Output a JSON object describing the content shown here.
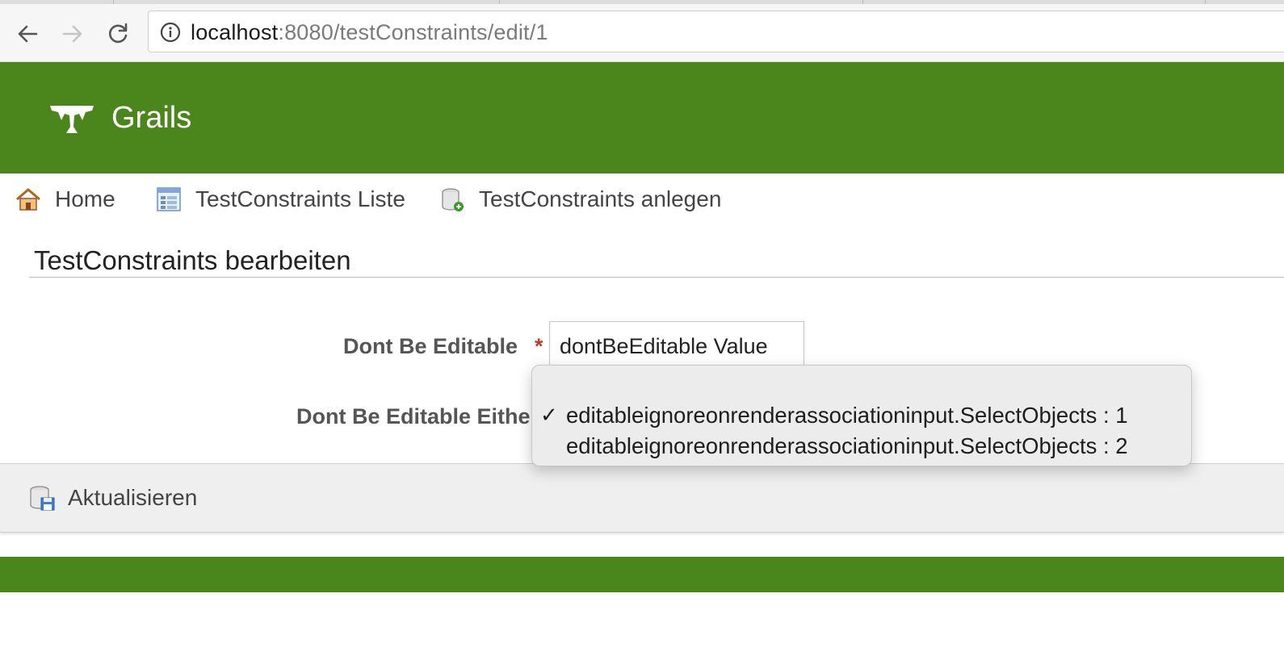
{
  "browser": {
    "url_host": "localhost",
    "url_rest": ":8080/testConstraints/edit/1"
  },
  "header": {
    "brand": "Grails"
  },
  "nav": {
    "items": [
      {
        "label": "Home",
        "icon": "home-icon"
      },
      {
        "label": "TestConstraints Liste",
        "icon": "list-icon"
      },
      {
        "label": "TestConstraints anlegen",
        "icon": "create-icon"
      }
    ]
  },
  "page": {
    "title": "TestConstraints bearbeiten"
  },
  "form": {
    "field1": {
      "label": "Dont Be Editable",
      "required_mark": "*",
      "value": "dontBeEditable Value"
    },
    "field2": {
      "label": "Dont Be Editable Eithe"
    }
  },
  "dropdown": {
    "check_mark": "✓",
    "options": [
      {
        "label": "editableignoreonrenderassociationinput.SelectObjects : 1",
        "selected": true
      },
      {
        "label": "editableignoreonrenderassociationinput.SelectObjects : 2",
        "selected": false
      }
    ]
  },
  "buttons": {
    "update_label": "Aktualisieren"
  },
  "colors": {
    "brand_green": "#4b861c",
    "required_red": "#c0392b"
  }
}
